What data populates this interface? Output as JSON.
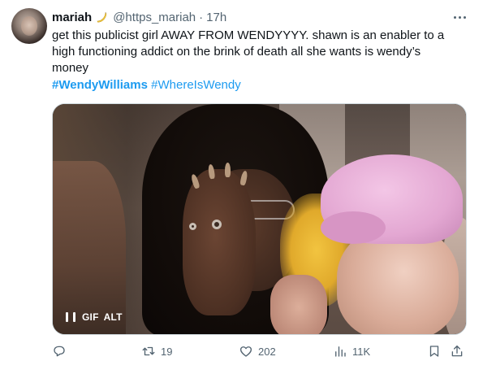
{
  "tweet": {
    "author": {
      "display_name": "mariah",
      "name_emoji": "banana-emoji",
      "handle": "@https_mariah",
      "separator": "·",
      "timestamp": "17h"
    },
    "text_lines": [
      "get this publicist girl AWAY FROM WENDYYYY.  shawn is an enabler to a",
      "high functioning addict on the brink of death all she wants is wendy’s",
      "money"
    ],
    "hashtags": [
      "#WendyWilliams",
      "#WhereIsWendy"
    ],
    "media": {
      "type": "gif",
      "badge_gif": "GIF",
      "badge_alt": "ALT",
      "state": "playing"
    },
    "actions": {
      "reply_count": "",
      "retweet_count": "19",
      "like_count": "202",
      "views_count": "11K"
    },
    "colors": {
      "text": "#0f1419",
      "secondary": "#536471",
      "link": "#1d9bf0"
    }
  }
}
